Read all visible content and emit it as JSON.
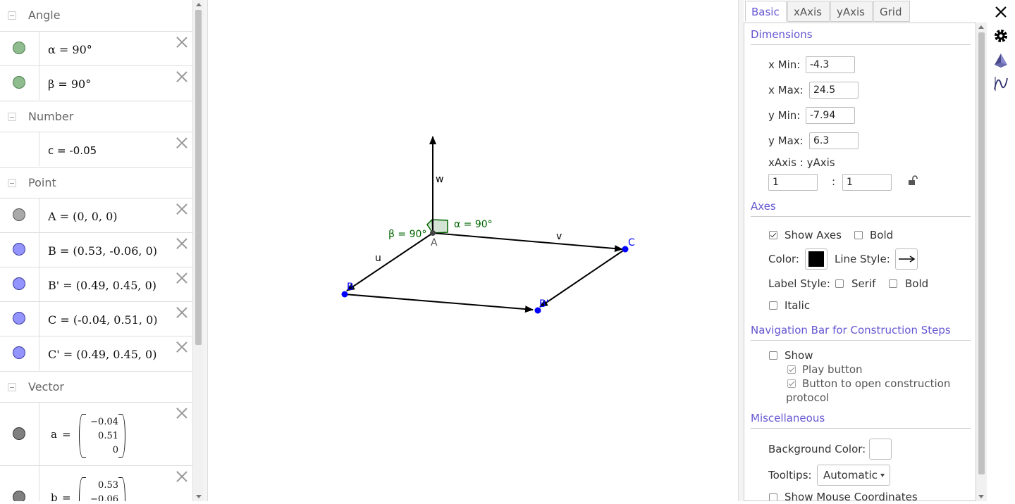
{
  "algebra": {
    "groups": [
      {
        "title": "Angle"
      },
      {
        "title": "Number"
      },
      {
        "title": "Point"
      },
      {
        "title": "Vector"
      }
    ],
    "rows": [
      {
        "expr": "α = 90°",
        "color": "#8fbc8f"
      },
      {
        "expr": "β = 90°",
        "color": "#8fbc8f"
      },
      {
        "expr": "c = -0.05"
      },
      {
        "expr": "A = (0, 0, 0)",
        "color": "#a9a9a9"
      },
      {
        "expr": "B = (0.53, -0.06, 0)",
        "color": "#9494ff"
      },
      {
        "expr": "B' = (0.49, 0.45, 0)",
        "color": "#9494ff"
      },
      {
        "expr": "C = (-0.04, 0.51, 0)",
        "color": "#9494ff"
      },
      {
        "expr": "C' = (0.49, 0.45, 0)",
        "color": "#9494ff"
      }
    ],
    "vectors": [
      {
        "name": "a",
        "values": [
          "−0.04",
          "0.51",
          "0"
        ],
        "color": "#808080"
      },
      {
        "name": "b",
        "values": [
          "0.53",
          "−0.06",
          ""
        ],
        "color": "#808080"
      }
    ]
  },
  "graphics": {
    "labels": {
      "w": "w",
      "u": "u",
      "v": "v",
      "A": "A",
      "B": "B",
      "Bp": "B'",
      "C": "C",
      "beta": "β = 90°",
      "alpha": "α = 90°"
    }
  },
  "props": {
    "tabs": [
      "Basic",
      "xAxis",
      "yAxis",
      "Grid"
    ],
    "dimensions": {
      "title": "Dimensions",
      "xmin_label": "x Min:",
      "xmin": "-4.3",
      "xmax_label": "x Max:",
      "xmax": "24.5",
      "ymin_label": "y Min:",
      "ymin": "-7.94",
      "ymax_label": "y Max:",
      "ymax": "6.3",
      "ratio_label": "xAxis : yAxis",
      "ratio_x": "1",
      "ratio_sep": ":",
      "ratio_y": "1"
    },
    "axes": {
      "title": "Axes",
      "show_axes": "Show Axes",
      "bold": "Bold",
      "color_label": "Color:",
      "color": "#000000",
      "line_style_label": "Line Style:",
      "label_style": "Label Style:",
      "serif": "Serif",
      "bold2": "Bold",
      "italic": "Italic"
    },
    "navbar": {
      "title": "Navigation Bar for Construction Steps",
      "show": "Show",
      "play": "Play button",
      "protocol_1": "Button to open construction",
      "protocol_2": "protocol"
    },
    "misc": {
      "title": "Miscellaneous",
      "bg_label": "Background Color:",
      "tooltips_label": "Tooltips:",
      "tooltips_value": "Automatic",
      "mouse_coords": "Show Mouse Coordinates"
    }
  },
  "colors": {
    "accent": "#6557d2",
    "point_blue": "#0000ff",
    "angle_green": "#006400"
  }
}
